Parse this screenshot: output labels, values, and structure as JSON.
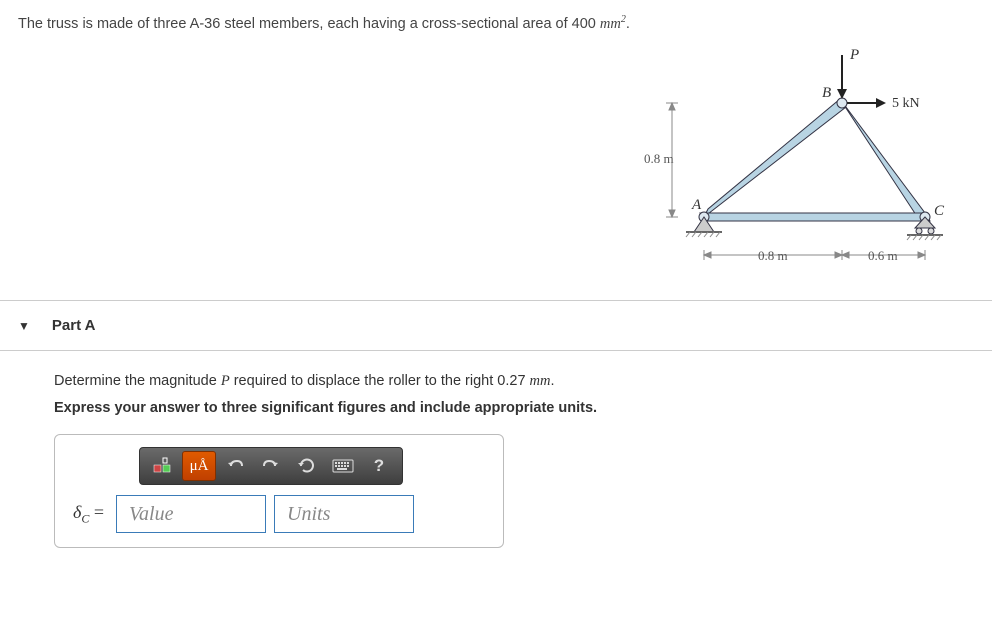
{
  "problem": {
    "text_prefix": "The truss is made of three A-36 steel members, each having a cross-sectional area of 400 ",
    "unit_html": "mm",
    "unit_sup": "2",
    "text_suffix": "."
  },
  "figure": {
    "labels": {
      "P": "P",
      "B": "B",
      "A": "A",
      "C": "C",
      "force5kN": "5 kN",
      "dim_v": "0.8 m",
      "dim_h1": "0.8 m",
      "dim_h2": "0.6 m"
    }
  },
  "partA": {
    "title": "Part A",
    "prompt_prefix": "Determine the magnitude ",
    "prompt_var": "P",
    "prompt_mid": " required to displace the roller to the right 0.27 ",
    "prompt_unit": "mm",
    "prompt_suffix": ".",
    "instruction": "Express your answer to three significant figures and include appropriate units.",
    "answer_label_delta": "δ",
    "answer_label_sub": "C",
    "equals": " = ",
    "value_placeholder": "Value",
    "units_placeholder": "Units"
  },
  "toolbar": {
    "templates": "templates",
    "units_btn": "μÅ",
    "undo": "undo",
    "redo": "redo",
    "reset": "reset",
    "keyboard": "keyboard",
    "help": "?"
  }
}
